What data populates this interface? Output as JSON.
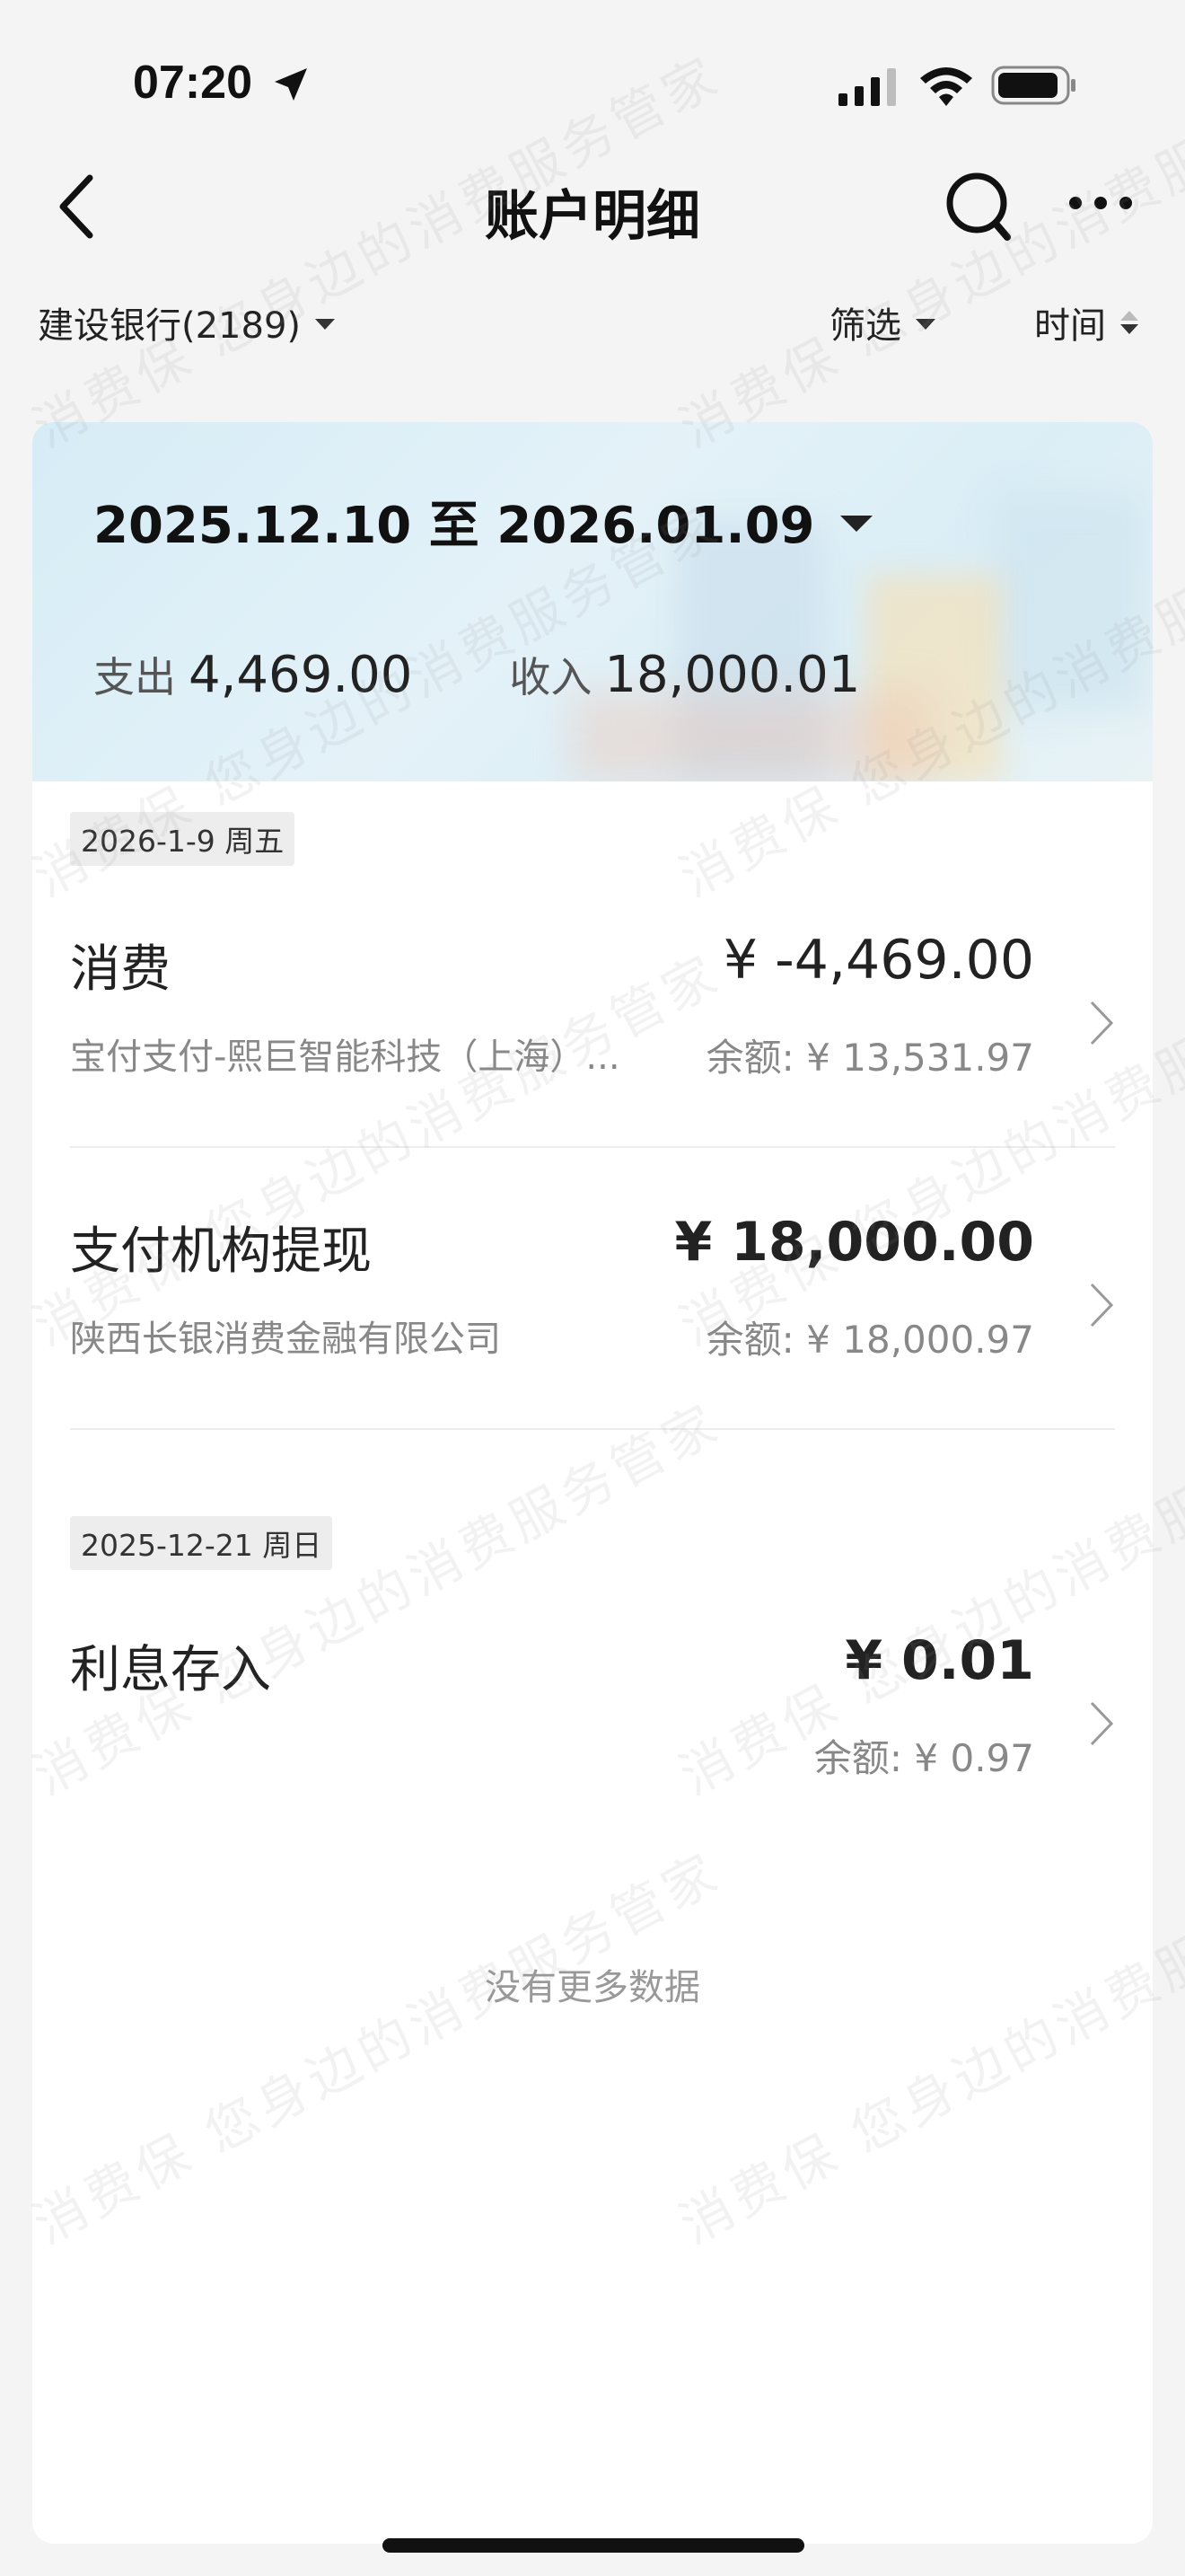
{
  "status_bar": {
    "time": "07:20"
  },
  "navbar": {
    "title": "账户明细"
  },
  "filters": {
    "account": "建设银行(2189)",
    "filter_label": "筛选",
    "sort_label": "时间"
  },
  "summary": {
    "date_range": "2025.12.10 至 2026.01.09",
    "expense_label": "支出",
    "expense_value": "4,469.00",
    "income_label": "收入",
    "income_value": "18,000.01"
  },
  "groups": [
    {
      "date": "2026-1-9 周五",
      "transactions": [
        {
          "title": "消费",
          "amount": "¥ -4,469.00",
          "merchant": "宝付支付-熙巨智能科技（上海）...",
          "balance": "余额: ¥ 13,531.97"
        },
        {
          "title": "支付机构提现",
          "amount": "¥ 18,000.00",
          "merchant": "陕西长银消费金融有限公司",
          "balance": "余额: ¥ 18,000.97"
        }
      ]
    },
    {
      "date": "2025-12-21 周日",
      "transactions": [
        {
          "title": "利息存入",
          "amount": "¥ 0.01",
          "merchant": "",
          "balance": "余额: ¥ 0.97"
        }
      ]
    }
  ],
  "footer": {
    "no_more": "没有更多数据"
  },
  "watermark": {
    "text": "消费保 您身边的消费服务管家"
  },
  "colors": {
    "background": "#f4f4f5",
    "card_gradient_start": "#d6ecf6",
    "text_primary": "#222222",
    "text_secondary": "#888888"
  }
}
